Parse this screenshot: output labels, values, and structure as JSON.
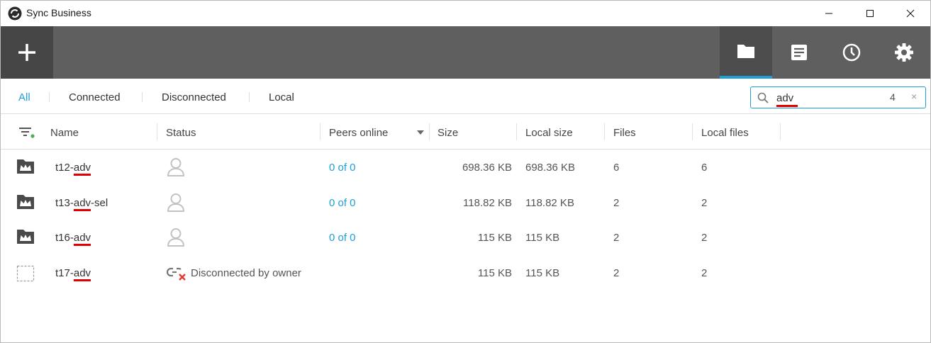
{
  "window": {
    "title": "Sync Business"
  },
  "filters": {
    "tabs": [
      "All",
      "Connected",
      "Disconnected",
      "Local"
    ],
    "active": "All"
  },
  "search": {
    "value": "adv",
    "count": "4",
    "clear": "×"
  },
  "columns": {
    "name": "Name",
    "status": "Status",
    "peers": "Peers online",
    "size": "Size",
    "local_size": "Local size",
    "files": "Files",
    "local_files": "Local files"
  },
  "rows": [
    {
      "name_prefix": "t12-",
      "name_match": "adv",
      "name_suffix": "",
      "icon": "shared-folder-icon",
      "status": "",
      "status_icon": "user-icon",
      "peers": "0 of 0",
      "size": "698.36 KB",
      "local_size": "698.36 KB",
      "files": "6",
      "local_files": "6"
    },
    {
      "name_prefix": "t13-",
      "name_match": "adv",
      "name_suffix": "-sel",
      "icon": "shared-folder-icon",
      "status": "",
      "status_icon": "user-icon",
      "peers": "0 of 0",
      "size": "118.82 KB",
      "local_size": "118.82 KB",
      "files": "2",
      "local_files": "2"
    },
    {
      "name_prefix": "t16-",
      "name_match": "adv",
      "name_suffix": "",
      "icon": "shared-folder-icon",
      "status": "",
      "status_icon": "user-icon",
      "peers": "0 of 0",
      "size": "115 KB",
      "local_size": "115 KB",
      "files": "2",
      "local_files": "2"
    },
    {
      "name_prefix": "t17-",
      "name_match": "adv",
      "name_suffix": "",
      "icon": "disconnected-folder-icon",
      "status": "Disconnected by owner",
      "status_icon": "broken-link-icon",
      "peers": "",
      "size": "115 KB",
      "local_size": "115 KB",
      "files": "2",
      "local_files": "2"
    }
  ],
  "colors": {
    "accent": "#1e9fd6",
    "toolbar": "#5f5f5f",
    "highlight": "#e00000",
    "error": "#e53935"
  }
}
